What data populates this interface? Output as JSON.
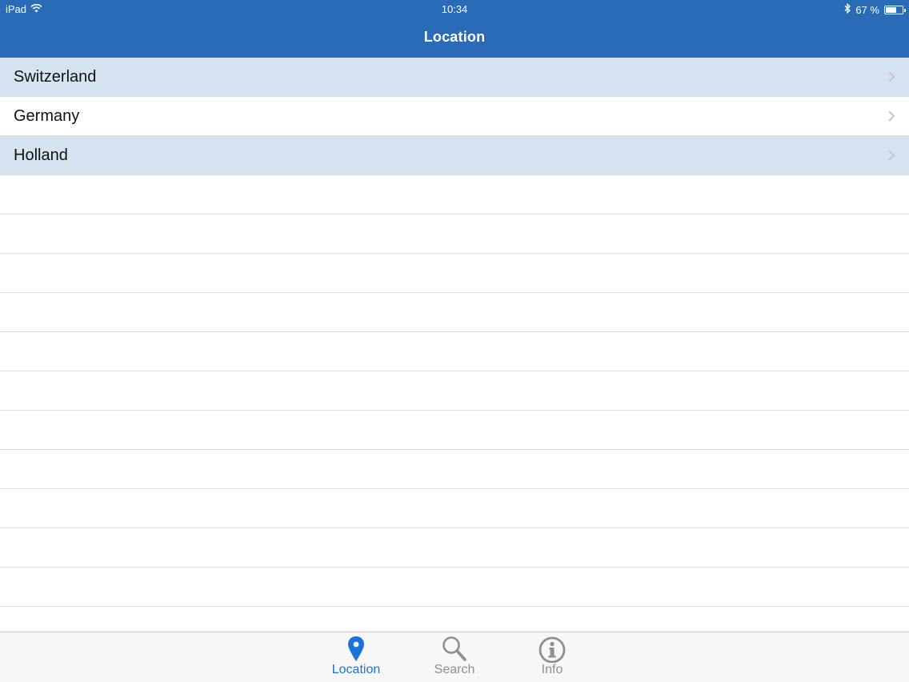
{
  "status_bar": {
    "device": "iPad",
    "time": "10:34",
    "battery": "67 %",
    "battery_level": 0.67,
    "icons": [
      "wifi-icon",
      "bluetooth-icon",
      "battery-icon"
    ]
  },
  "nav": {
    "title": "Location"
  },
  "list": {
    "items": [
      {
        "label": "Switzerland"
      },
      {
        "label": "Germany"
      },
      {
        "label": "Holland"
      }
    ]
  },
  "tabbar": {
    "tabs": [
      {
        "label": "Location",
        "icon": "map-pin-icon",
        "active": true
      },
      {
        "label": "Search",
        "icon": "search-icon",
        "active": false
      },
      {
        "label": "Info",
        "icon": "info-icon",
        "active": false
      }
    ]
  },
  "colors": {
    "nav_background": "#2a6bb8",
    "row_alternate": "#d6e4f2",
    "tab_active": "#1a73d9",
    "tab_inactive": "#8e8e93"
  }
}
